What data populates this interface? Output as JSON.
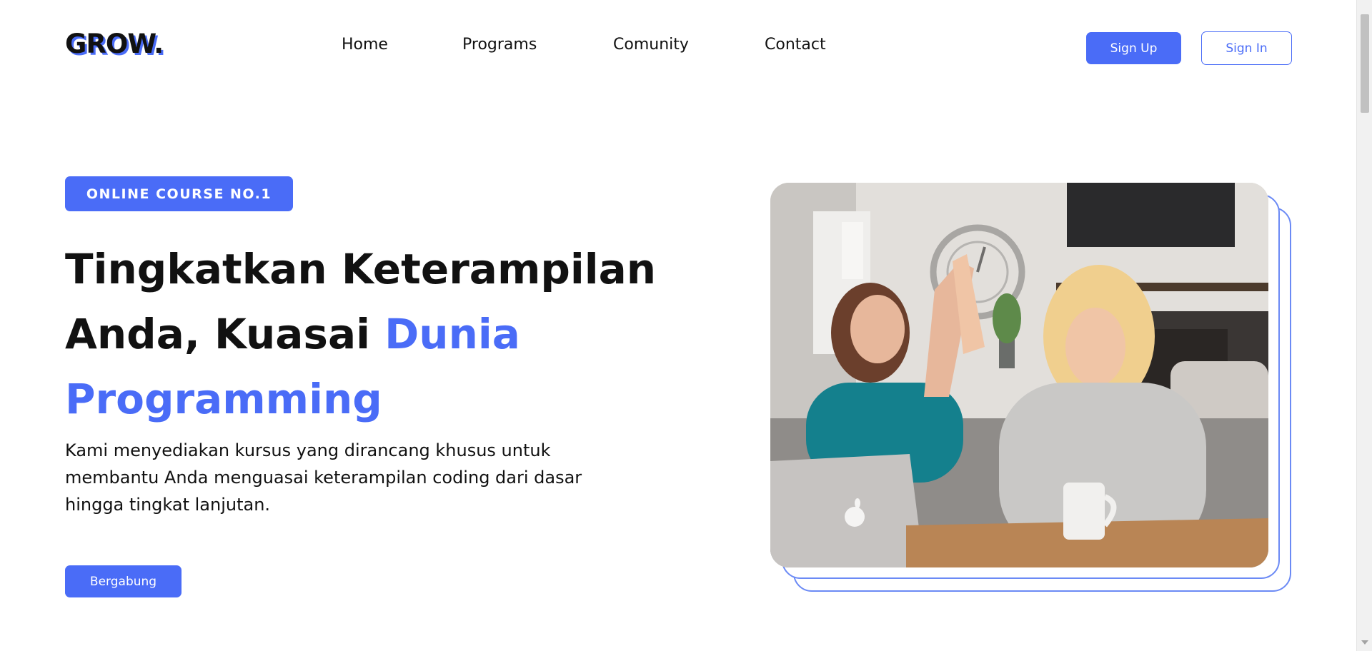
{
  "header": {
    "logo": "GROW.",
    "nav": [
      "Home",
      "Programs",
      "Comunity",
      "Contact"
    ],
    "signup_label": "Sign Up",
    "signin_label": "Sign In"
  },
  "hero": {
    "badge": "ONLINE COURSE NO.1",
    "headline_line1": "Tingkatkan Keterampilan",
    "headline_line2_plain": "Anda, Kuasai ",
    "headline_line2_accent": "Dunia",
    "headline_line3_accent": "Programming",
    "description_line1": "Kami menyediakan kursus yang dirancang khusus untuk",
    "description_line2": "membantu Anda menguasai keterampilan coding dari dasar",
    "description_line3": "hingga tingkat lanjutan.",
    "join_label": "Bergabung"
  },
  "colors": {
    "accent": "#4a6cf7",
    "text": "#111111",
    "background": "#ffffff"
  },
  "icons": [
    "apple-logo-icon"
  ]
}
